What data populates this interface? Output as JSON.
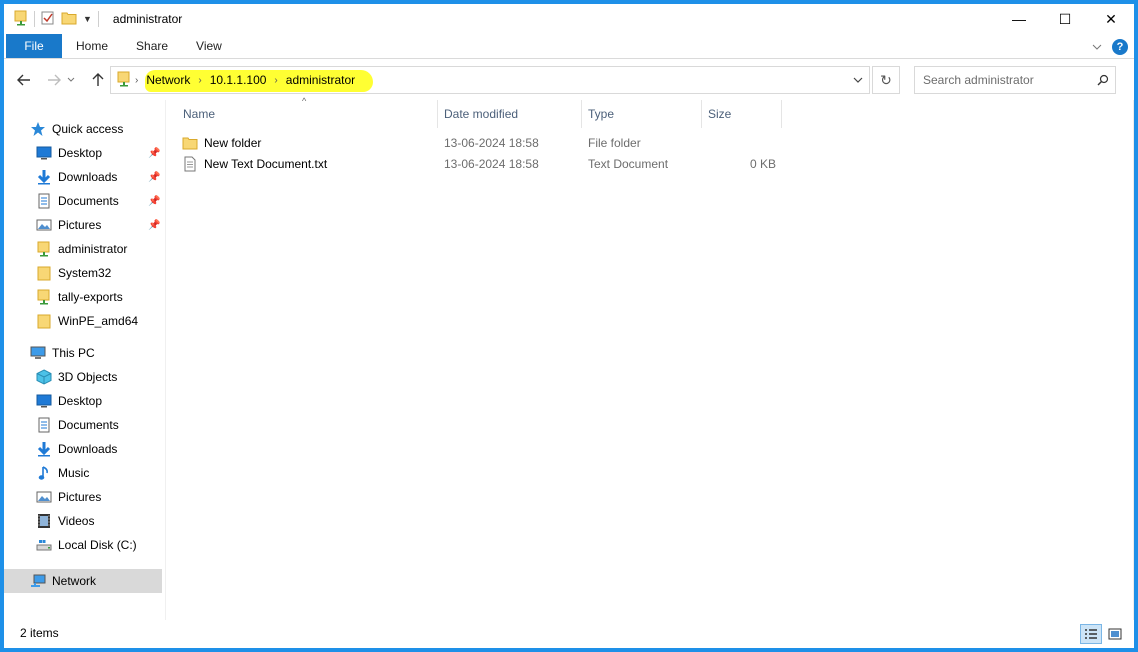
{
  "window": {
    "title": "administrator",
    "buttons": {
      "minimize": "—",
      "maximize": "☐",
      "close": "✕"
    }
  },
  "ribbon": {
    "tabs": [
      "File",
      "Home",
      "Share",
      "View"
    ],
    "help": "?"
  },
  "address": {
    "crumbs": [
      "Network",
      "10.1.1.100",
      "administrator"
    ],
    "highlight_color": "#ffff33"
  },
  "search": {
    "placeholder": "Search administrator"
  },
  "nav": {
    "quick_access": {
      "label": "Quick access",
      "items": [
        {
          "label": "Desktop",
          "icon": "desktop-icon",
          "pinned": true
        },
        {
          "label": "Downloads",
          "icon": "downloads-icon",
          "pinned": true
        },
        {
          "label": "Documents",
          "icon": "documents-icon",
          "pinned": true
        },
        {
          "label": "Pictures",
          "icon": "pictures-icon",
          "pinned": true
        },
        {
          "label": "administrator",
          "icon": "network-folder-icon",
          "pinned": false
        },
        {
          "label": "System32",
          "icon": "folder-icon",
          "pinned": false
        },
        {
          "label": "tally-exports",
          "icon": "network-folder-icon",
          "pinned": false
        },
        {
          "label": "WinPE_amd64",
          "icon": "folder-icon",
          "pinned": false
        }
      ]
    },
    "this_pc": {
      "label": "This PC",
      "items": [
        {
          "label": "3D Objects",
          "icon": "3d-objects-icon"
        },
        {
          "label": "Desktop",
          "icon": "desktop-icon"
        },
        {
          "label": "Documents",
          "icon": "documents-icon"
        },
        {
          "label": "Downloads",
          "icon": "downloads-icon"
        },
        {
          "label": "Music",
          "icon": "music-icon"
        },
        {
          "label": "Pictures",
          "icon": "pictures-icon"
        },
        {
          "label": "Videos",
          "icon": "videos-icon"
        },
        {
          "label": "Local Disk (C:)",
          "icon": "local-disk-icon"
        }
      ]
    },
    "network": {
      "label": "Network",
      "selected": true
    }
  },
  "columns": {
    "name": "Name",
    "date": "Date modified",
    "type": "Type",
    "size": "Size"
  },
  "files": [
    {
      "name": "New folder",
      "date": "13-06-2024 18:58",
      "type": "File folder",
      "size": "",
      "icon": "folder-icon"
    },
    {
      "name": "New Text Document.txt",
      "date": "13-06-2024 18:58",
      "type": "Text Document",
      "size": "0 KB",
      "icon": "text-file-icon"
    }
  ],
  "status": {
    "items": "2 items"
  },
  "colors": {
    "accent": "#1979ca",
    "folder": "#f8d775",
    "selection": "#d9d9d9"
  }
}
